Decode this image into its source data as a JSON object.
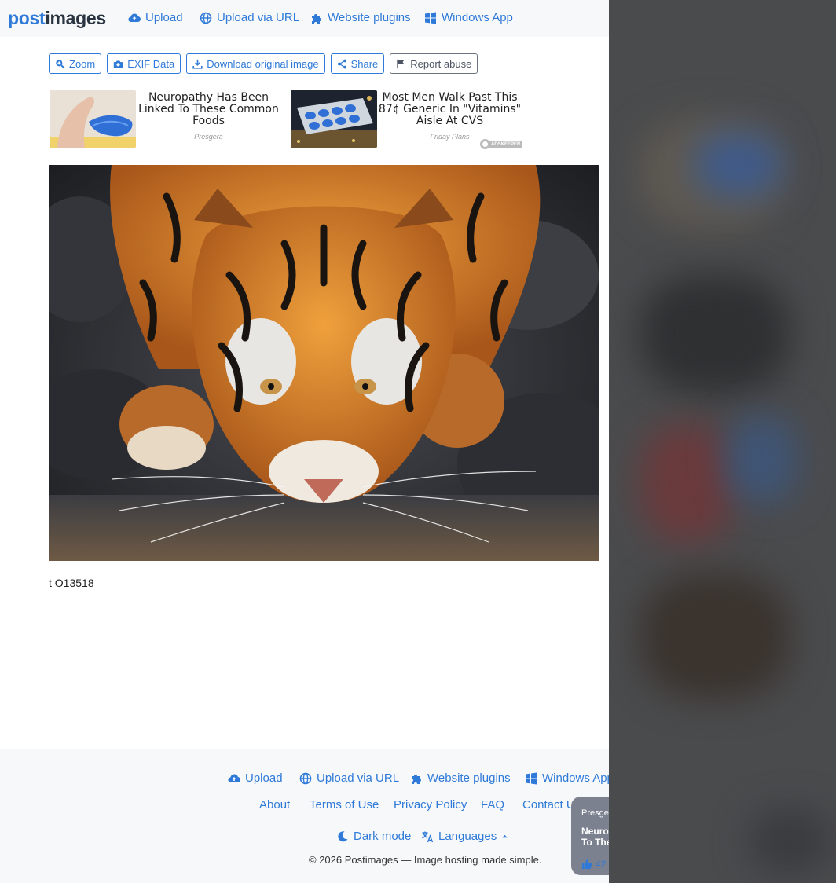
{
  "header": {
    "logo_post": "post",
    "logo_images": "images",
    "nav": [
      {
        "label": "Upload",
        "icon": "cloud-upload-icon"
      },
      {
        "label": "Upload via URL",
        "icon": "globe-icon"
      },
      {
        "label": "Website plugins",
        "icon": "puzzle-icon"
      },
      {
        "label": "Windows App",
        "icon": "windows-icon"
      }
    ]
  },
  "toolbar": {
    "zoom": "Zoom",
    "exif": "EXIF Data",
    "download": "Download original image",
    "share": "Share",
    "report": "Report abuse"
  },
  "ads": [
    {
      "title": "Neuropathy Has Been Linked To These Common Foods",
      "source": "Presgera"
    },
    {
      "title": "Most Men Walk Past This 87¢ Generic In \"Vitamins\" Aisle At CVS",
      "source": "Friday Plans"
    }
  ],
  "adskeeper_label": "ADSKEEPER",
  "image_caption": "t O13518",
  "footer": {
    "nav": [
      {
        "label": "Upload",
        "icon": "cloud-upload-icon"
      },
      {
        "label": "Upload via URL",
        "icon": "globe-icon"
      },
      {
        "label": "Website plugins",
        "icon": "puzzle-icon"
      },
      {
        "label": "Windows App",
        "icon": "windows-icon"
      }
    ],
    "links": [
      "About",
      "Terms of Use",
      "Privacy Policy",
      "FAQ",
      "Contact U"
    ],
    "dark_mode": "Dark mode",
    "languages": "Languages",
    "copyright": "© 2026 Postimages — Image hosting made simple."
  },
  "popup": {
    "source": "Presge",
    "title_line1": "Neuro",
    "title_line2": "To The",
    "likes": "42"
  },
  "colors": {
    "accent": "#2f7ad8",
    "logo_dark": "#2a3440",
    "header_bg": "#f6f8fa",
    "overlay": "#4a4b4d"
  }
}
